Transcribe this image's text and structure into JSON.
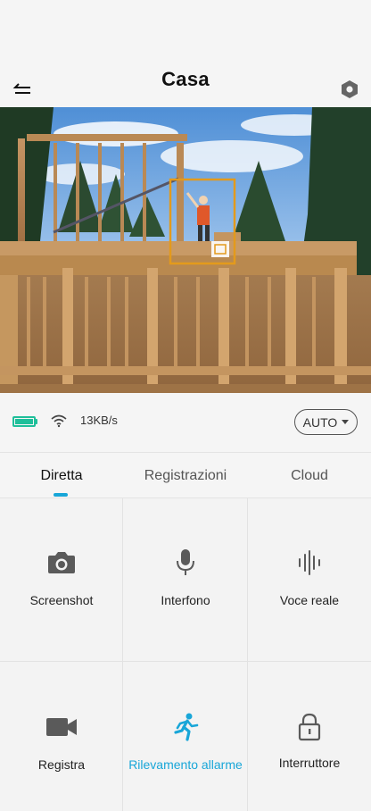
{
  "header": {
    "title": "Casa"
  },
  "status": {
    "network_speed": "13KB/s",
    "quality_label": "AUTO"
  },
  "tabs": [
    {
      "label": "Diretta",
      "active": true
    },
    {
      "label": "Registrazioni",
      "active": false
    },
    {
      "label": "Cloud",
      "active": false
    }
  ],
  "actions": [
    {
      "label": "Screenshot",
      "icon": "camera-icon"
    },
    {
      "label": "Interfono",
      "icon": "microphone-icon"
    },
    {
      "label": "Voce reale",
      "icon": "voice-waveform-icon"
    },
    {
      "label": "Registra",
      "icon": "video-camera-icon"
    },
    {
      "label": "Rilevamento allarme",
      "icon": "running-person-icon",
      "active": true
    },
    {
      "label": "Interruttore",
      "icon": "lock-icon"
    }
  ],
  "colors": {
    "accent": "#18a6d8",
    "battery": "#1fbf9a",
    "detection_box": "#e39a1c"
  }
}
